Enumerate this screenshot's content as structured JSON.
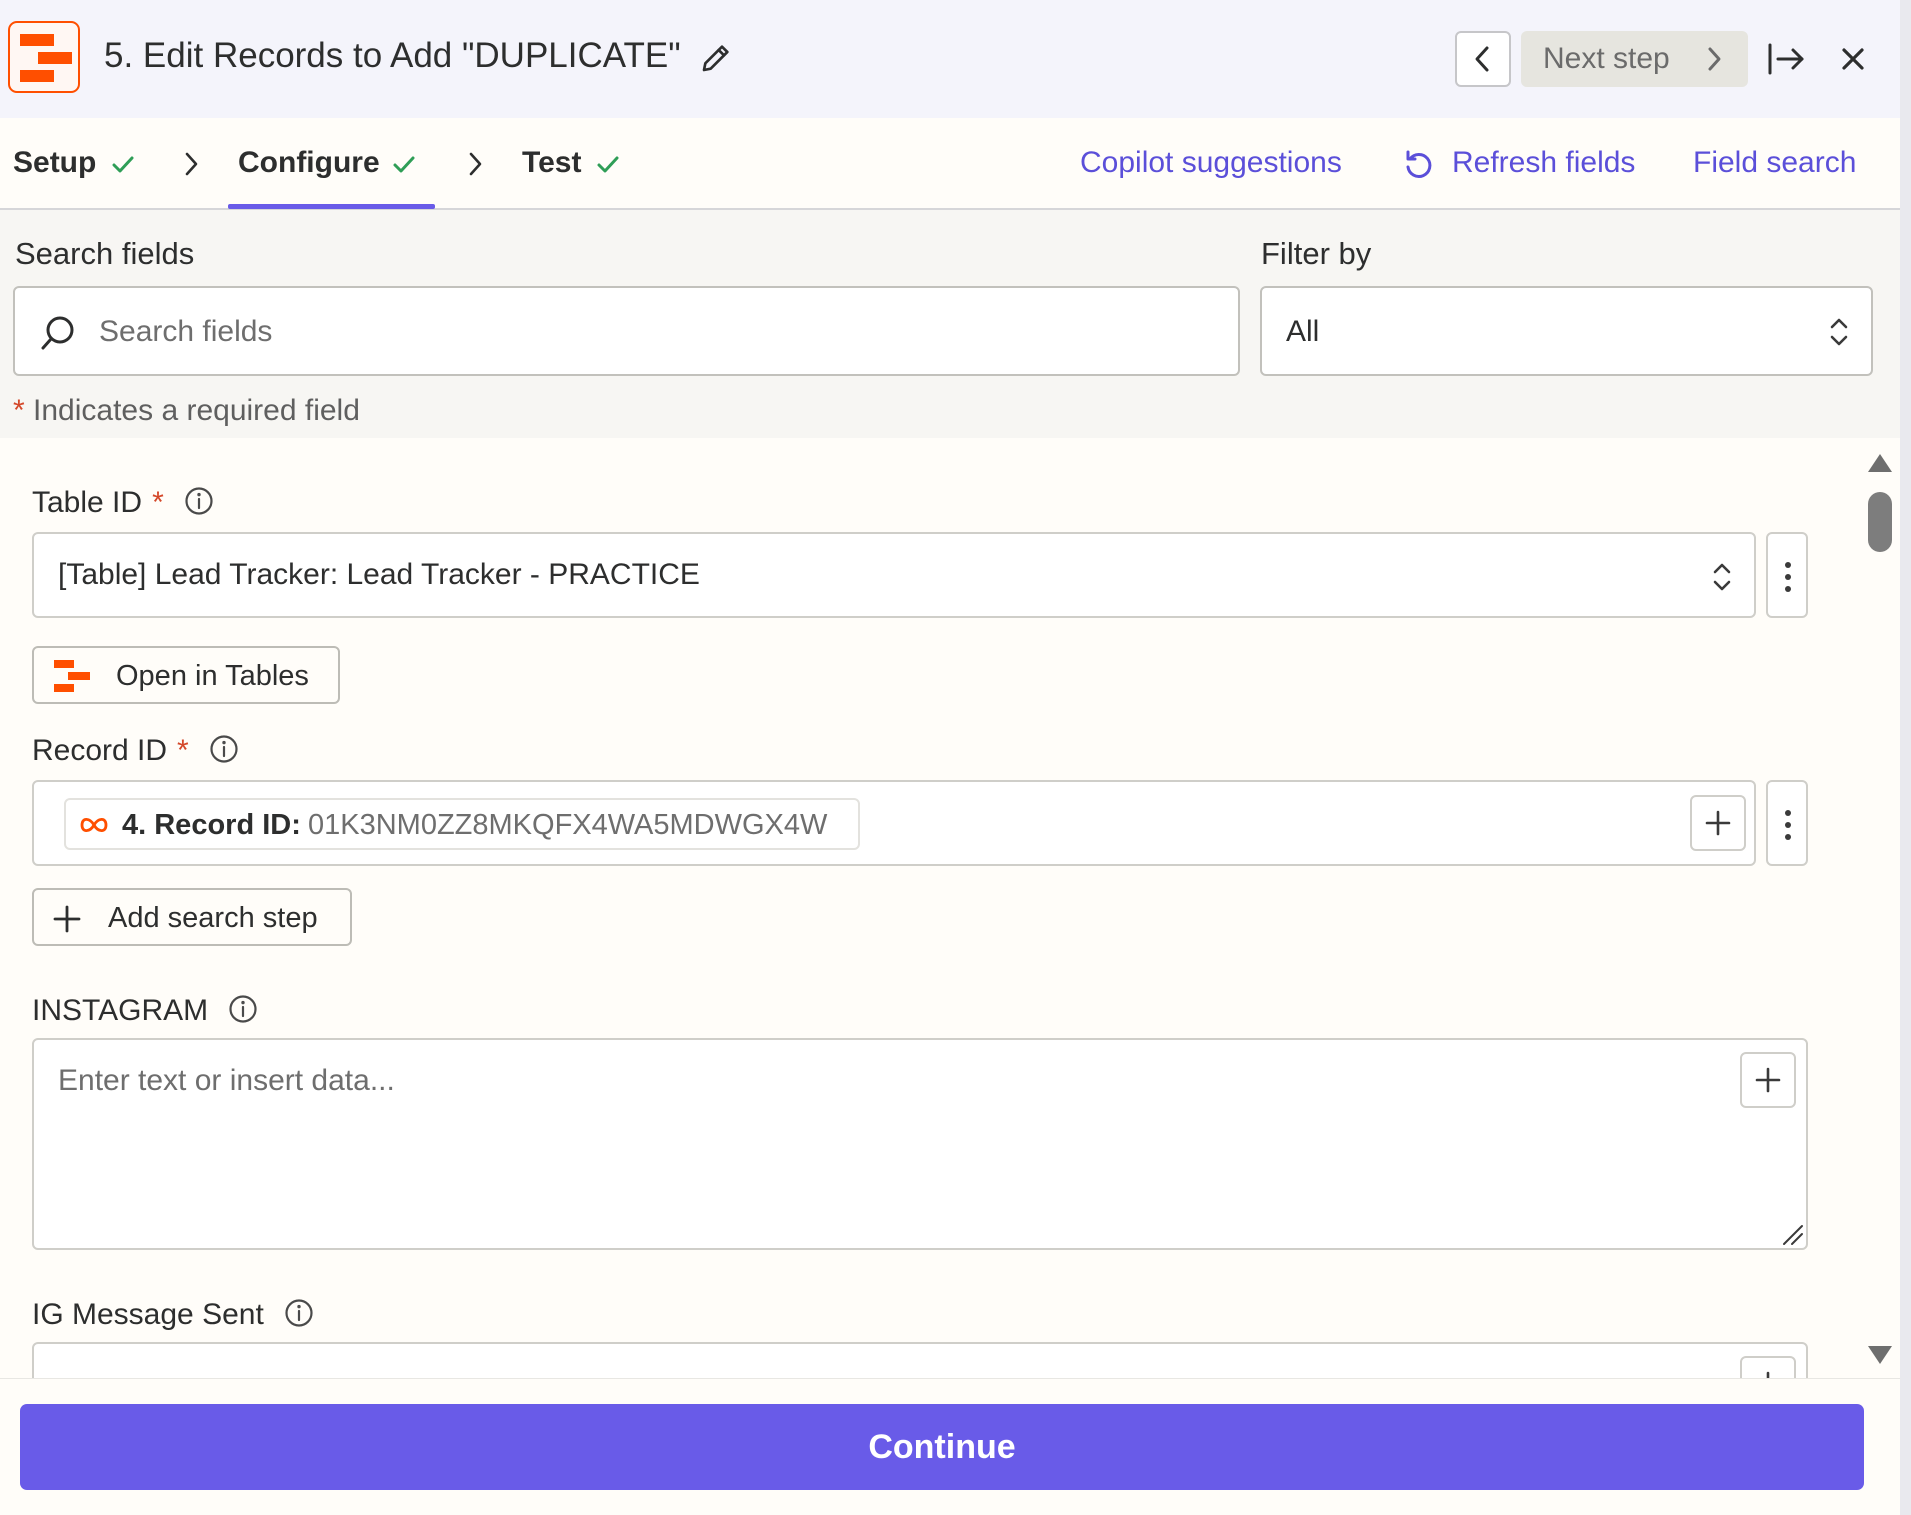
{
  "header": {
    "title": "5. Edit Records to Add \"DUPLICATE\"",
    "next_step_label": "Next step"
  },
  "tabs": [
    {
      "label": "Setup",
      "completed": true
    },
    {
      "label": "Configure",
      "completed": true,
      "active": true
    },
    {
      "label": "Test",
      "completed": true
    }
  ],
  "actions": {
    "copilot": "Copilot suggestions",
    "refresh": "Refresh fields",
    "field_search": "Field search"
  },
  "filter": {
    "search_label": "Search fields",
    "search_placeholder": "Search fields",
    "filter_label": "Filter by",
    "filter_value": "All",
    "required_note_star": "*",
    "required_note": "Indicates a required field"
  },
  "fields": {
    "table_id": {
      "label": "Table ID",
      "required_mark": "*",
      "value": "[Table] Lead Tracker: Lead Tracker - PRACTICE",
      "open_button": "Open in Tables"
    },
    "record_id": {
      "label": "Record ID",
      "required_mark": "*",
      "pill_name": "4. Record ID:",
      "pill_value": "01K3NM0ZZ8MKQFX4WA5MDWGX4W",
      "add_search_step": "Add search step"
    },
    "instagram": {
      "label": "INSTAGRAM",
      "placeholder": "Enter text or insert data..."
    },
    "ig_message_sent": {
      "label": "IG Message Sent"
    }
  },
  "footer": {
    "continue_label": "Continue"
  },
  "colors": {
    "accent": "#695be8",
    "brand": "#ff4f00",
    "success": "#2f9e57",
    "required": "#d4482a"
  }
}
